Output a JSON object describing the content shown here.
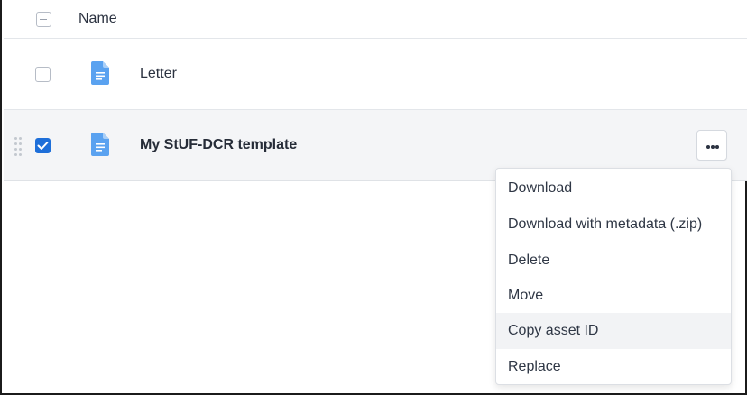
{
  "header": {
    "select_all_state": "indeterminate",
    "name_label": "Name"
  },
  "rows": [
    {
      "label": "Letter",
      "checked": false,
      "icon": "document-icon"
    },
    {
      "label": "My StUF-DCR template",
      "checked": true,
      "icon": "document-icon"
    }
  ],
  "more_button": {
    "icon": "ellipsis-icon"
  },
  "menu": {
    "items": [
      {
        "label": "Download"
      },
      {
        "label": "Download with metadata (.zip)"
      },
      {
        "label": "Delete"
      },
      {
        "label": "Move"
      },
      {
        "label": "Copy asset ID"
      },
      {
        "label": "Replace"
      }
    ],
    "hovered_item": "Copy asset ID"
  },
  "colors": {
    "accent": "#1e6fd9",
    "doc_icon": "#5aa2f0",
    "selected_row_bg": "#f4f5f7"
  }
}
